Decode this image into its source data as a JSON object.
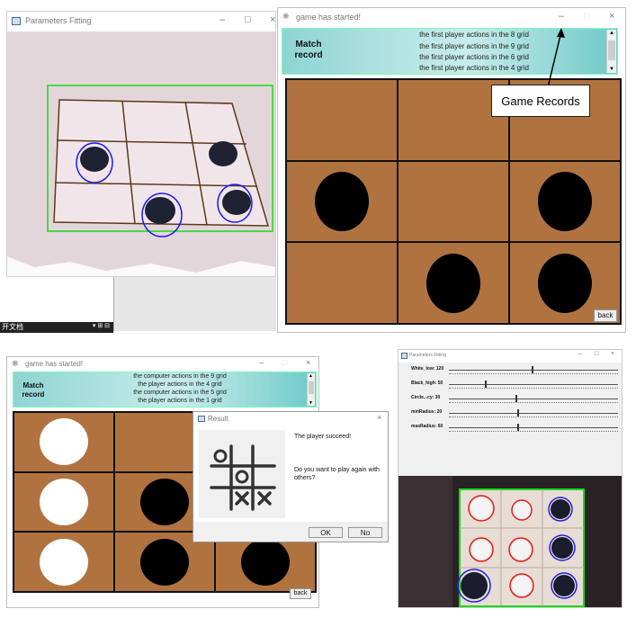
{
  "panel_a": {
    "title": "Parameters Fitting",
    "controls": [
      "–",
      "□",
      "×"
    ],
    "camera": {
      "detected_pieces": 4,
      "marker_color_black": "#1a1af0",
      "roi_color": "#19d919"
    }
  },
  "panel_b": {
    "title": "game has started!",
    "controls": [
      "–",
      "□",
      "×"
    ],
    "record_label_line1": "Match",
    "record_label_line2": "record",
    "records": [
      "the first player actions in the 8 grid",
      "the first player actions in the 9 grid",
      "the first player actions in the 6 grid",
      "the first player actions in the 4 grid"
    ],
    "callout": "Game Records",
    "back_label": "back",
    "board": [
      "",
      "",
      "",
      "black",
      "",
      "black",
      "",
      "black",
      "black"
    ]
  },
  "panel_c": {
    "title": "game has started!",
    "controls": [
      "–",
      "□",
      "×"
    ],
    "record_label_line1": "Match",
    "record_label_line2": "record",
    "records": [
      "the computer actions in the 9 grid",
      "the player actions in the 4 grid",
      "the computer actions in the 5 grid",
      "the player actions in the 1 grid"
    ],
    "back_label": "back",
    "board": [
      "white",
      "",
      "",
      "white",
      "black",
      "",
      "white",
      "black",
      "black"
    ]
  },
  "dialog": {
    "title": "Result",
    "close": "×",
    "message1": "The player succeed!",
    "message2": "Do you want to play again with others?",
    "ok_label": "OK",
    "no_label": "No"
  },
  "panel_d": {
    "title": "Parameters Fitting",
    "controls": [
      "–",
      "□",
      "×"
    ],
    "sliders": [
      {
        "label": "White_low: 120",
        "value": 120,
        "max": 255
      },
      {
        "label": "Black_high: 50",
        "value": 50,
        "max": 255
      },
      {
        "label": "Circle...cy: 30",
        "value": 30,
        "max": 100
      },
      {
        "label": "minRadius: 20",
        "value": 20,
        "max": 100
      },
      {
        "label": "maxRadius: 60",
        "value": 60,
        "max": 200
      }
    ],
    "camera": {
      "white_marker": "#e02020",
      "black_marker": "#2020e0",
      "roi_color": "#19d919"
    }
  },
  "taskbar": {
    "text": "开文档"
  }
}
